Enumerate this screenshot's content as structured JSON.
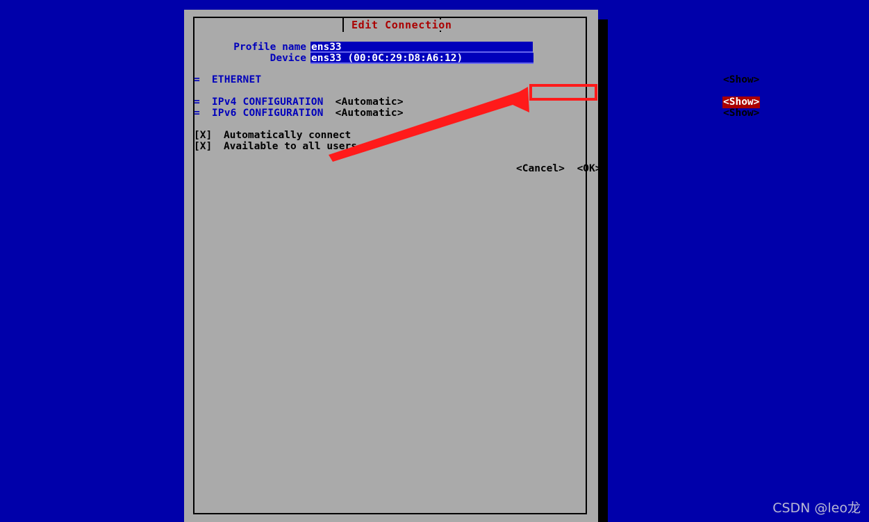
{
  "desktop": {
    "background_color": "#0000aa"
  },
  "window": {
    "title": "Edit Connection",
    "title_color": "#aa0000",
    "background_color": "#aaaaaa"
  },
  "form": {
    "fields": [
      {
        "label": "Profile name",
        "value": "ens33"
      },
      {
        "label": "Device",
        "value": "ens33 (00:0C:29:D8:A6:12)"
      }
    ],
    "sections": [
      {
        "marker": "=",
        "name": "ETHERNET",
        "value": "",
        "button": "<Show>",
        "selected": false
      },
      {
        "marker": "=",
        "name": "IPv4 CONFIGURATION",
        "value": "<Automatic>",
        "button": "<Show>",
        "selected": true
      },
      {
        "marker": "=",
        "name": "IPv6 CONFIGURATION",
        "value": "<Automatic>",
        "button": "<Show>",
        "selected": false
      }
    ],
    "checkboxes": [
      {
        "mark": "[X]",
        "label": "Automatically connect"
      },
      {
        "mark": "[X]",
        "label": "Available to all users"
      }
    ],
    "buttons": {
      "cancel": "<Cancel>",
      "ok": "<OK>"
    }
  },
  "annotation": {
    "color": "#ff1a1a",
    "target": "<Show>"
  },
  "watermark": {
    "text": "CSDN @leo龙"
  }
}
